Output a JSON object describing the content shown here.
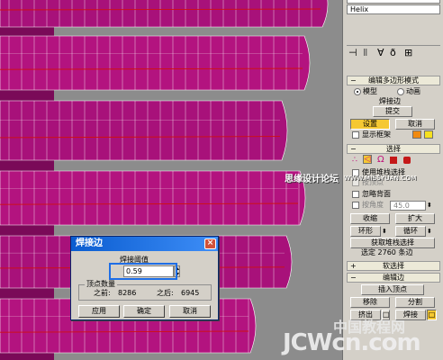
{
  "panel": {
    "object_name": "Helix",
    "modifier_title": "编辑多边形模式",
    "mode_model": "模型",
    "mode_animate": "动画",
    "mode_current": "焊接边",
    "commit": "提交",
    "settings": "设置",
    "cancel": "取消",
    "show_cage": "显示框架",
    "select_rollout": "选择",
    "use_stack_selection": "使用堆栈选择",
    "by_vertex": "按顶点",
    "ignore_backfacing": "忽略背面",
    "by_angle_label": "按角度",
    "by_angle_value": "45.0",
    "shrink": "收缩",
    "grow": "扩大",
    "ring": "环形",
    "loop": "循环",
    "get_stack_selection": "获取堆栈选择",
    "selection_status": "选定 2760 条边",
    "soft_selection": "软选择",
    "edit_edges": "编辑边",
    "insert_vertex": "插入顶点",
    "remove": "移除",
    "split": "分割",
    "extrude": "挤出",
    "weld": "焊接"
  },
  "dialog": {
    "title": "焊接边",
    "threshold_label": "焊接阈值",
    "threshold_value": "0.59",
    "vertex_count_label": "顶点数量",
    "before_label": "之前:",
    "before_value": "8286",
    "after_label": "之后:",
    "after_value": "6945",
    "apply": "应用",
    "ok": "确定",
    "cancel": "取消"
  },
  "watermarks": {
    "forum": "思缘设计论坛",
    "forum_url": "WWW.MISSYUAN.COM",
    "site_cn": "中国教程网",
    "site_brand": "JCWcn.com"
  },
  "colors": {
    "mesh_front": "#b3137f",
    "mesh_back": "#8f0d68",
    "wire": "#ffffff",
    "selected_edge": "#d01010",
    "panel_bg": "#d4d0c8",
    "accent_yellow": "#f5c832",
    "dialog_title": "#0a5cd0"
  }
}
